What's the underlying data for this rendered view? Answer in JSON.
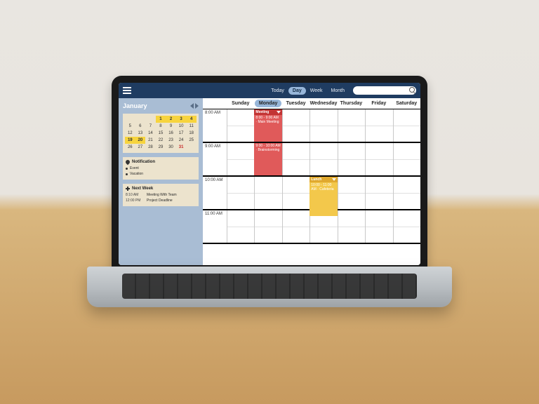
{
  "topbar": {
    "views": [
      {
        "label": "Today",
        "active": false
      },
      {
        "label": "Day",
        "active": true
      },
      {
        "label": "Week",
        "active": false
      },
      {
        "label": "Month",
        "active": false
      }
    ],
    "search_placeholder": ""
  },
  "sidebar": {
    "month": "January",
    "calendar_days": [
      [
        "",
        "",
        "",
        "1",
        "2",
        "3",
        "4"
      ],
      [
        "5",
        "6",
        "7",
        "8",
        "9",
        "10",
        "11"
      ],
      [
        "12",
        "13",
        "14",
        "15",
        "16",
        "17",
        "18"
      ],
      [
        "19",
        "20",
        "21",
        "22",
        "23",
        "24",
        "25"
      ],
      [
        "26",
        "27",
        "28",
        "29",
        "30",
        "31",
        ""
      ]
    ],
    "highlight_days": [
      "1",
      "2",
      "3",
      "4",
      "19",
      "20"
    ],
    "red_days": [
      "31"
    ],
    "notification": {
      "title": "Notification",
      "items": [
        "Event",
        "Vacation"
      ]
    },
    "next_week": {
      "title": "Next Week",
      "items": [
        {
          "time": "8:10 AM",
          "label": "Meeting With Team"
        },
        {
          "time": "12:00 PM",
          "label": "Project Deadline"
        }
      ]
    }
  },
  "schedule": {
    "days": [
      "Sunday",
      "Monday",
      "Tuesday",
      "Wednesday",
      "Thursday",
      "Friday",
      "Saturday"
    ],
    "selected_day_index": 1,
    "hours": [
      "8:00 AM",
      "9:00 AM",
      "10:00 AM",
      "11:00 AM"
    ],
    "events": [
      {
        "title": "Meeting",
        "detail": "8:00 - 9:00 AM · Main Meeting",
        "color": "red",
        "day": 1,
        "start": 0,
        "span": 1
      },
      {
        "title": "",
        "detail": "9:00 - 10:00 AM · Brainstorming",
        "color": "red",
        "day": 1,
        "start": 1,
        "span": 1
      },
      {
        "title": "Lunch",
        "detail": "10:00 - 11:00 AM · Cafeteria",
        "color": "yellow",
        "day": 3,
        "start": 2,
        "span": 1.2
      }
    ]
  }
}
